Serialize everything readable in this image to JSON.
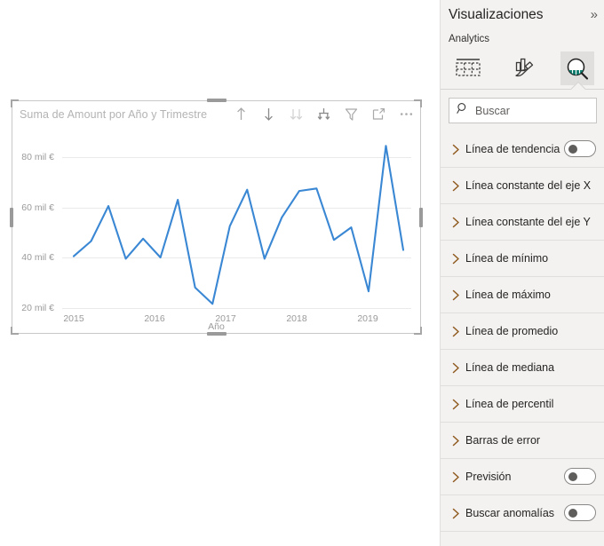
{
  "visual": {
    "title": "Suma de Amount por Año y Trimestre",
    "header_icons": [
      {
        "name": "drill-up-icon",
        "label": "Explorar en profundidad hacia arriba"
      },
      {
        "name": "drill-down-icon",
        "label": "Explorar en profundidad"
      },
      {
        "name": "expand-all-icon",
        "label": "Expandir todo un nivel"
      },
      {
        "name": "drill-mode-icon",
        "label": "Ir al siguiente nivel de la jerarquía"
      },
      {
        "name": "filter-icon",
        "label": "Filtros"
      },
      {
        "name": "focus-mode-icon",
        "label": "Modo de enfoque"
      },
      {
        "name": "more-options-icon",
        "label": "Más opciones"
      }
    ]
  },
  "chart_data": {
    "type": "line",
    "title": "Suma de Amount por Año y Trimestre",
    "xlabel": "Año",
    "ylabel": "",
    "grid": true,
    "legend": "none",
    "line_color": "#3a87d4",
    "ylim": [
      14000,
      90000
    ],
    "yticks": [
      20000,
      40000,
      60000,
      80000
    ],
    "ytick_labels": [
      "20 mil €",
      "40 mil €",
      "60 mil €",
      "80 mil €"
    ],
    "xticks": [
      "2015",
      "2016",
      "2017",
      "2018",
      "2019"
    ],
    "x": [
      "2015 Q1",
      "2015 Q2",
      "2015 Q3",
      "2015 Q4",
      "2016 Q1",
      "2016 Q2",
      "2016 Q3",
      "2016 Q4",
      "2017 Q1",
      "2017 Q2",
      "2017 Q3",
      "2017 Q4",
      "2018 Q1",
      "2018 Q2",
      "2018 Q3",
      "2018 Q4",
      "2019 Q1",
      "2019 Q2",
      "2019 Q3",
      "2019 Q4"
    ],
    "series": [
      {
        "name": "Suma de Amount",
        "values": [
          40500,
          46500,
          60500,
          39500,
          47500,
          40000,
          63000,
          28000,
          21500,
          52500,
          67000,
          39500,
          56000,
          66500,
          67500,
          47000,
          52000,
          26500,
          84500,
          43000
        ]
      }
    ]
  },
  "panel": {
    "title": "Visualizaciones",
    "collapse_icon": "»",
    "subtitle": "Analytics",
    "tabs": [
      {
        "name": "tab-fields",
        "icon": "fields-icon",
        "active": false
      },
      {
        "name": "tab-format",
        "icon": "format-paintbrush-icon",
        "active": false
      },
      {
        "name": "tab-analytics",
        "icon": "analytics-magnifier-icon",
        "active": true
      }
    ],
    "search": {
      "placeholder": "Buscar",
      "value": ""
    },
    "items": [
      {
        "label": "Línea de tendencia",
        "toggle": true,
        "toggle_on": false
      },
      {
        "label": "Línea constante del eje X",
        "toggle": false
      },
      {
        "label": "Línea constante del eje Y",
        "toggle": false
      },
      {
        "label": "Línea de mínimo",
        "toggle": false
      },
      {
        "label": "Línea de máximo",
        "toggle": false
      },
      {
        "label": "Línea de promedio",
        "toggle": false
      },
      {
        "label": "Línea de mediana",
        "toggle": false
      },
      {
        "label": "Línea de percentil",
        "toggle": false
      },
      {
        "label": "Barras de error",
        "toggle": false
      },
      {
        "label": "Previsión",
        "toggle": true,
        "toggle_on": false
      },
      {
        "label": "Buscar anomalías",
        "toggle": true,
        "toggle_on": false
      }
    ]
  }
}
